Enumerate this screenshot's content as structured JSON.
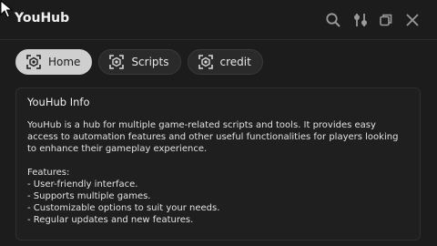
{
  "window": {
    "title": "YouHub",
    "controls": [
      "search-icon",
      "settings-sliders-icon",
      "restore-icon",
      "close-icon"
    ]
  },
  "tabs": [
    {
      "label": "Home",
      "icon": "script-icon",
      "active": true
    },
    {
      "label": "Scripts",
      "icon": "script-icon",
      "active": false
    },
    {
      "label": "credit",
      "icon": "script-icon",
      "active": false
    }
  ],
  "panel": {
    "title": "YouHub Info",
    "description": "YouHub is a hub for multiple game-related scripts and tools. It provides easy access to automation features and other useful functionalities for players looking to enhance their gameplay experience.",
    "features_heading": "Features:",
    "features": [
      "- User-friendly interface.",
      "- Supports multiple games.",
      "- Customizable options to suit your needs.",
      "- Regular updates and new features."
    ]
  },
  "colors": {
    "background": "#1c1c1c",
    "active_tab": "#cfcfcf",
    "text": "#e8e8e8"
  }
}
